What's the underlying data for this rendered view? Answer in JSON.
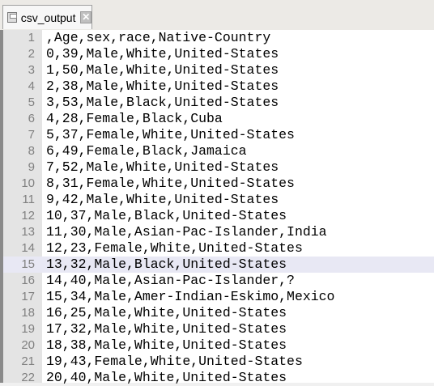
{
  "tab": {
    "title": "csv_output",
    "close": "✕"
  },
  "editor": {
    "current_line": 15,
    "lines": [
      ",Age,sex,race,Native-Country",
      "0,39,Male,White,United-States",
      "1,50,Male,White,United-States",
      "2,38,Male,White,United-States",
      "3,53,Male,Black,United-States",
      "4,28,Female,Black,Cuba",
      "5,37,Female,White,United-States",
      "6,49,Female,Black,Jamaica",
      "7,52,Male,White,United-States",
      "8,31,Female,White,United-States",
      "9,42,Male,White,United-States",
      "10,37,Male,Black,United-States",
      "11,30,Male,Asian-Pac-Islander,India",
      "12,23,Female,White,United-States",
      "13,32,Male,Black,United-States",
      "14,40,Male,Asian-Pac-Islander,?",
      "15,34,Male,Amer-Indian-Eskimo,Mexico",
      "16,25,Male,White,United-States",
      "17,32,Male,White,United-States",
      "18,38,Male,White,United-States",
      "19,43,Female,White,United-States",
      "20,40,Male,White,United-States"
    ]
  }
}
